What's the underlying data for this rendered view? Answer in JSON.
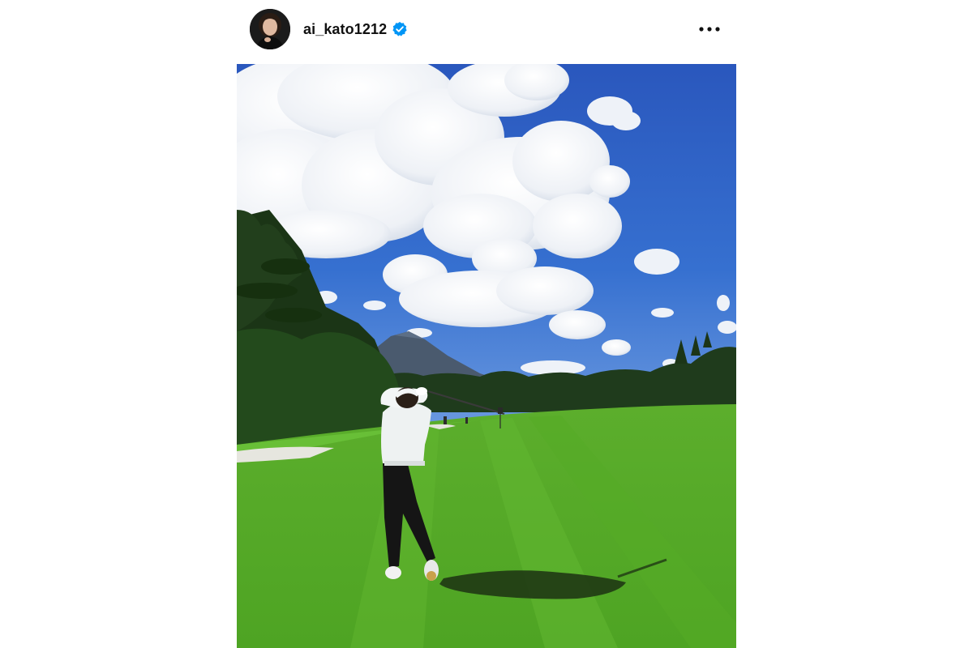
{
  "post": {
    "username": "ai_kato1212",
    "verified": true
  },
  "icons": {
    "avatar": "profile-photo",
    "verified": "verified-badge-icon",
    "more": "more-horizontal-icon"
  },
  "colors": {
    "verified_blue": "#0095f6",
    "sky": "#2f62c4",
    "grass": "#59b52a"
  }
}
